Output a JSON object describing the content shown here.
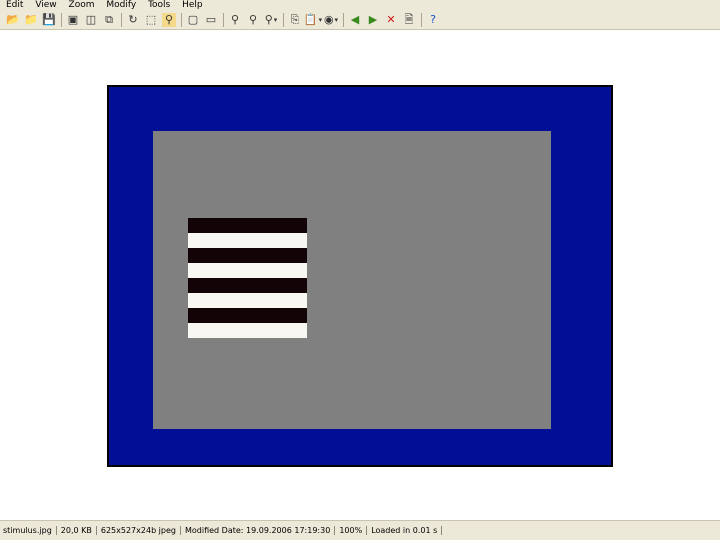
{
  "menu": [
    "Edit",
    "View",
    "Zoom",
    "Modify",
    "Tools",
    "Help"
  ],
  "toolbar": {
    "icons": [
      "open-folder-icon",
      "browse-icon",
      "save-icon",
      "separator",
      "thumbnails-icon",
      "slideshow-icon",
      "fullscreen-icon",
      "separator",
      "rotate-icon",
      "crop-icon",
      "zoom-tool-icon",
      "separator",
      "fit-window-icon",
      "actual-size-icon",
      "separator",
      "zoom-in-icon",
      "zoom-out-icon",
      "zoom-dropdown-icon",
      "separator",
      "copy-icon",
      "paste-dropdown-icon",
      "effects-dropdown-icon",
      "separator",
      "previous-image-icon",
      "next-image-icon",
      "delete-icon",
      "properties-icon",
      "separator",
      "help-icon"
    ]
  },
  "image": {
    "frame_color": "#000f96",
    "field_color": "#808080",
    "stripes": [
      "dark",
      "light",
      "dark",
      "light",
      "dark",
      "light",
      "dark",
      "light"
    ]
  },
  "status": {
    "filename": "stimulus.jpg",
    "coords": "20,0 KB",
    "dimensions": "625x527x24b jpeg",
    "modified": "Modified Date: 19.09.2006 17:19:30",
    "zoom": "100%",
    "loaded": "Loaded in 0.01 s"
  }
}
